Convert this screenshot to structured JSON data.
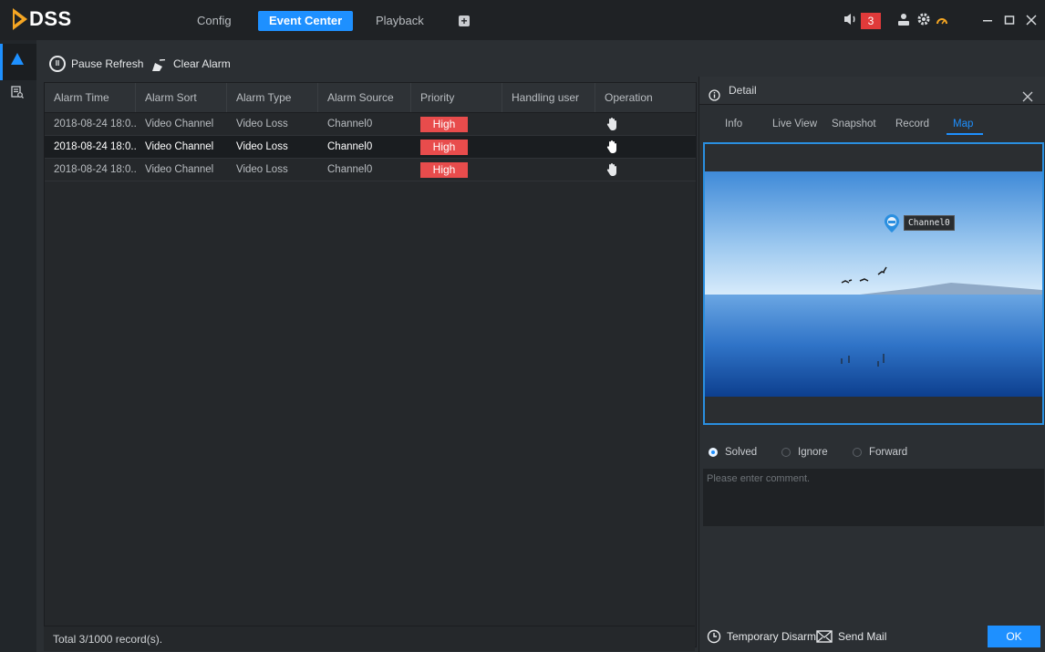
{
  "app": {
    "logo_text": "DSS"
  },
  "top_nav": {
    "tabs": [
      {
        "label": "Config"
      },
      {
        "label": "Event Center"
      },
      {
        "label": "Playback"
      }
    ],
    "alarm_count": "3"
  },
  "toolbar": {
    "pause_label": "Pause Refresh",
    "clear_label": "Clear Alarm"
  },
  "table": {
    "headers": [
      "Alarm Time",
      "Alarm Sort",
      "Alarm Type",
      "Alarm Source",
      "Priority",
      "Handling user",
      "Operation"
    ],
    "rows": [
      {
        "time": "2018-08-24 18:0...",
        "sort": "Video Channel",
        "type": "Video Loss",
        "source": "Channel0",
        "priority": "High",
        "user": ""
      },
      {
        "time": "2018-08-24 18:0...",
        "sort": "Video Channel",
        "type": "Video Loss",
        "source": "Channel0",
        "priority": "High",
        "user": ""
      },
      {
        "time": "2018-08-24 18:0...",
        "sort": "Video Channel",
        "type": "Video Loss",
        "source": "Channel0",
        "priority": "High",
        "user": ""
      }
    ],
    "footer": "Total 3/1000 record(s)."
  },
  "detail": {
    "title": "Detail",
    "tabs": [
      "Info",
      "Live View",
      "Snapshot",
      "Record",
      "Map"
    ],
    "map_marker_label": "Channel0",
    "radios": [
      "Solved",
      "Ignore",
      "Forward"
    ],
    "comment_placeholder": "Please enter comment.",
    "temp_disarm_label": "Temporary Disarm",
    "send_mail_label": "Send Mail",
    "ok_label": "OK"
  },
  "colors": {
    "accent": "#1e90ff",
    "alarm_red": "#e84c4c",
    "logo_orange": "#f5a623"
  }
}
